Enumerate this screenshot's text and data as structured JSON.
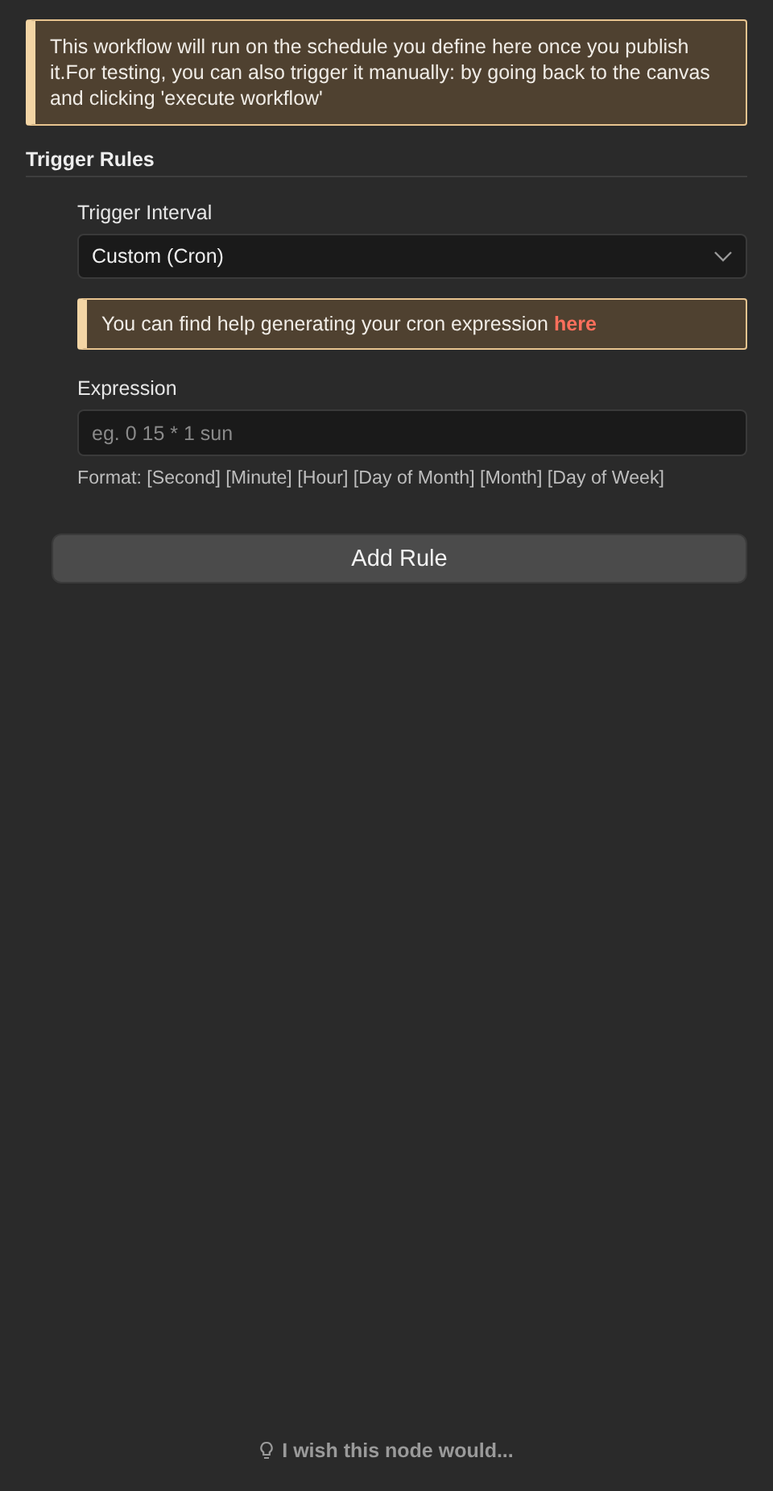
{
  "notice": {
    "text": "This workflow will run on the schedule you define here once you publish it.For testing, you can also trigger it manually: by going back to the canvas and clicking 'execute workflow'"
  },
  "section": {
    "title": "Trigger Rules"
  },
  "interval": {
    "label": "Trigger Interval",
    "value": "Custom (Cron)"
  },
  "help": {
    "text": "You can find help generating your cron expression",
    "link": "here"
  },
  "expression": {
    "label": "Expression",
    "placeholder": "eg. 0 15 * 1 sun",
    "hint": "Format: [Second] [Minute] [Hour] [Day of Month] [Month] [Day of Week]"
  },
  "add_button": {
    "label": "Add Rule"
  },
  "feedback": {
    "label": "I wish this node would..."
  }
}
